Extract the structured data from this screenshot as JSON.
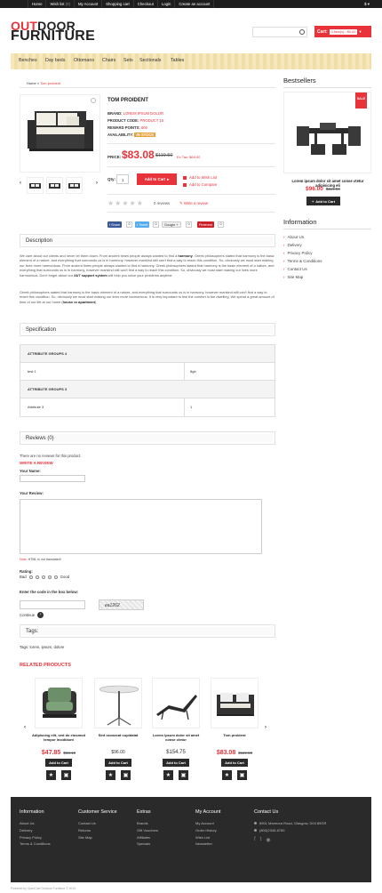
{
  "topbar": {
    "nav": [
      "Home",
      "Wish list",
      "(0)",
      "My Account",
      "Shopping cart",
      "Checkout",
      "Login",
      "Create an account"
    ],
    "currency": "$ ▾"
  },
  "logo": {
    "part1": "OUT",
    "part2": "DOOR",
    "part3": "FURNITURE"
  },
  "search": {
    "placeholder": ""
  },
  "cart": {
    "label": "Cart:",
    "value": "0 item(s) - $0.00",
    "arrow": "▾"
  },
  "menu": [
    "Benches",
    "Day beds",
    "Ottomans",
    "Chairs",
    "Sets",
    "Sectionals",
    "Tables"
  ],
  "breadcrumb": {
    "home": "Home",
    "sep": "»",
    "current": "Tom proident"
  },
  "product": {
    "title": "TOM PROIDENT",
    "brand_label": "BRAND:",
    "brand": "LOREM IPSUM DOLOR",
    "code_label": "PRODUCT CODE:",
    "code": "PRODUCT 16",
    "reward_label": "REWARD POINTS:",
    "reward": "600",
    "avail_label": "AVAILABILITY:",
    "avail": "IN STOCK",
    "price_label": "PRICE:",
    "price": "$83.08",
    "old_price": "$119.50",
    "ex_tax": "Ex Tax: $69.00",
    "qty_label": "Qty:",
    "qty": "1",
    "add_to_cart": "Add to Cart",
    "wishlist": "Add to Wish List",
    "compare": "Add to Compare",
    "reviews_count": "0 reviews",
    "write_review": "Write a review",
    "rating": 0
  },
  "share": {
    "fb": "Share",
    "fb_count": "0",
    "tw": "Tweet",
    "tw_count": "0",
    "gp": "Google +",
    "gp_count": "0",
    "pin": "Pinterest",
    "pin_count": "0"
  },
  "description": {
    "heading": "Description",
    "p1a": "We care about our clients and never let them down. From ancient times people always wanted to find a ",
    "p1b": "harmony",
    "p1c": ". Greek philosophers stated that harmony is the basic element of a nature, and everything that surrounds us is in harmony, however mankind still can't find a way to reach this condition. So, obviously we must start making our lives more harmonious. From ancient times people always wanted to find a harmony. Greek philosophers stated that harmony is the basic element of a nature, and everything that surrounds us is in harmony, however mankind still can't find a way to reach this condition. So, obviously we must start making our lives more harmonious. Don't forget about our ",
    "p1d": "24/7 support system",
    "p1e": " will help you solve your problems anytime.",
    "p2a": "Greek philosophers stated that harmony is the basic element of a nature, and everything that surrounds us is in harmony, however mankind still can't find a way to reach this condition. So, obviously we must start making our lives more harmonious. It is very important to feel the comfort in the dwelling. We spend a great amount of time of our life at our home (",
    "p2b": "house or apartment",
    "p2c": ")."
  },
  "specification": {
    "heading": "Specification",
    "groups": [
      {
        "name": "ATTRIBUTE GROUPS 4",
        "rows": [
          {
            "k": "test 1",
            "v": "8gb"
          }
        ]
      },
      {
        "name": "ATTRIBUTE GROUPS 3",
        "rows": [
          {
            "k": "Attribute 3",
            "v": "1"
          }
        ]
      }
    ]
  },
  "reviews": {
    "heading": "Reviews (0)",
    "none": "There are no reviews for this product.",
    "write": "WRITE A REVIEW",
    "name_label": "Your Name:",
    "review_label": "Your Review:",
    "note_a": "Note:",
    "note_b": " HTML is not translated!",
    "rating_label": "Rating:",
    "bad": "Bad",
    "good": "Good",
    "captcha_label": "Enter the code in the box below:",
    "captcha": "ea1262",
    "continue": "Continue"
  },
  "tags": {
    "heading": "Tags:",
    "value": "Tags: lorem, ipsum, dolore"
  },
  "related": {
    "heading": "RELATED PRODUCTS",
    "items": [
      {
        "name": "Adipiscing elit, sed do eiusmod tempor incididunt",
        "price": "$47.85",
        "old": "$68.19",
        "btn": "Add to Cart"
      },
      {
        "name": "Sint occaecat cupidatat",
        "price": "$96.00",
        "old": "",
        "btn": "Add to Cart"
      },
      {
        "name": "Lorem ipsum dolor sit amet conse ctetur",
        "price": "$154.75",
        "old": "",
        "btn": "Add to Cart"
      },
      {
        "name": "Tom proident",
        "price": "$83.08",
        "old": "$119.50",
        "btn": "Add to Cart"
      }
    ]
  },
  "sidebar": {
    "bestsellers": "Bestsellers",
    "bs_sale": "SALE",
    "bs_name": "Lorem ipsum dolor sit amet conse ctetur adipisicing eli",
    "bs_price": "$96.00",
    "bs_old": "$119.50",
    "bs_btn": "Add to Cart",
    "information": "Information",
    "info_items": [
      "About Us",
      "Delivery",
      "Privacy Policy",
      "Terms & Conditions",
      "Contact Us",
      "Site Map"
    ]
  },
  "footer": {
    "cols": [
      {
        "h": "Information",
        "items": [
          "About Us",
          "Delivery",
          "Privacy Policy",
          "Terms & Conditions"
        ]
      },
      {
        "h": "Customer Service",
        "items": [
          "Contact Us",
          "Returns",
          "Site Map"
        ]
      },
      {
        "h": "Extras",
        "items": [
          "Brands",
          "Gift Vouchers",
          "Affiliates",
          "Specials"
        ]
      },
      {
        "h": "My Account",
        "items": [
          "My Account",
          "Order History",
          "Wish List",
          "Newsletter"
        ]
      }
    ],
    "contact_h": "Contact Us",
    "address": "8901 Marmora Road, Glasgow, D04 89GR",
    "phone": "(800)2345-6789"
  },
  "copyright": "Powered by OpenCart Outdoor Furniture © 2013"
}
